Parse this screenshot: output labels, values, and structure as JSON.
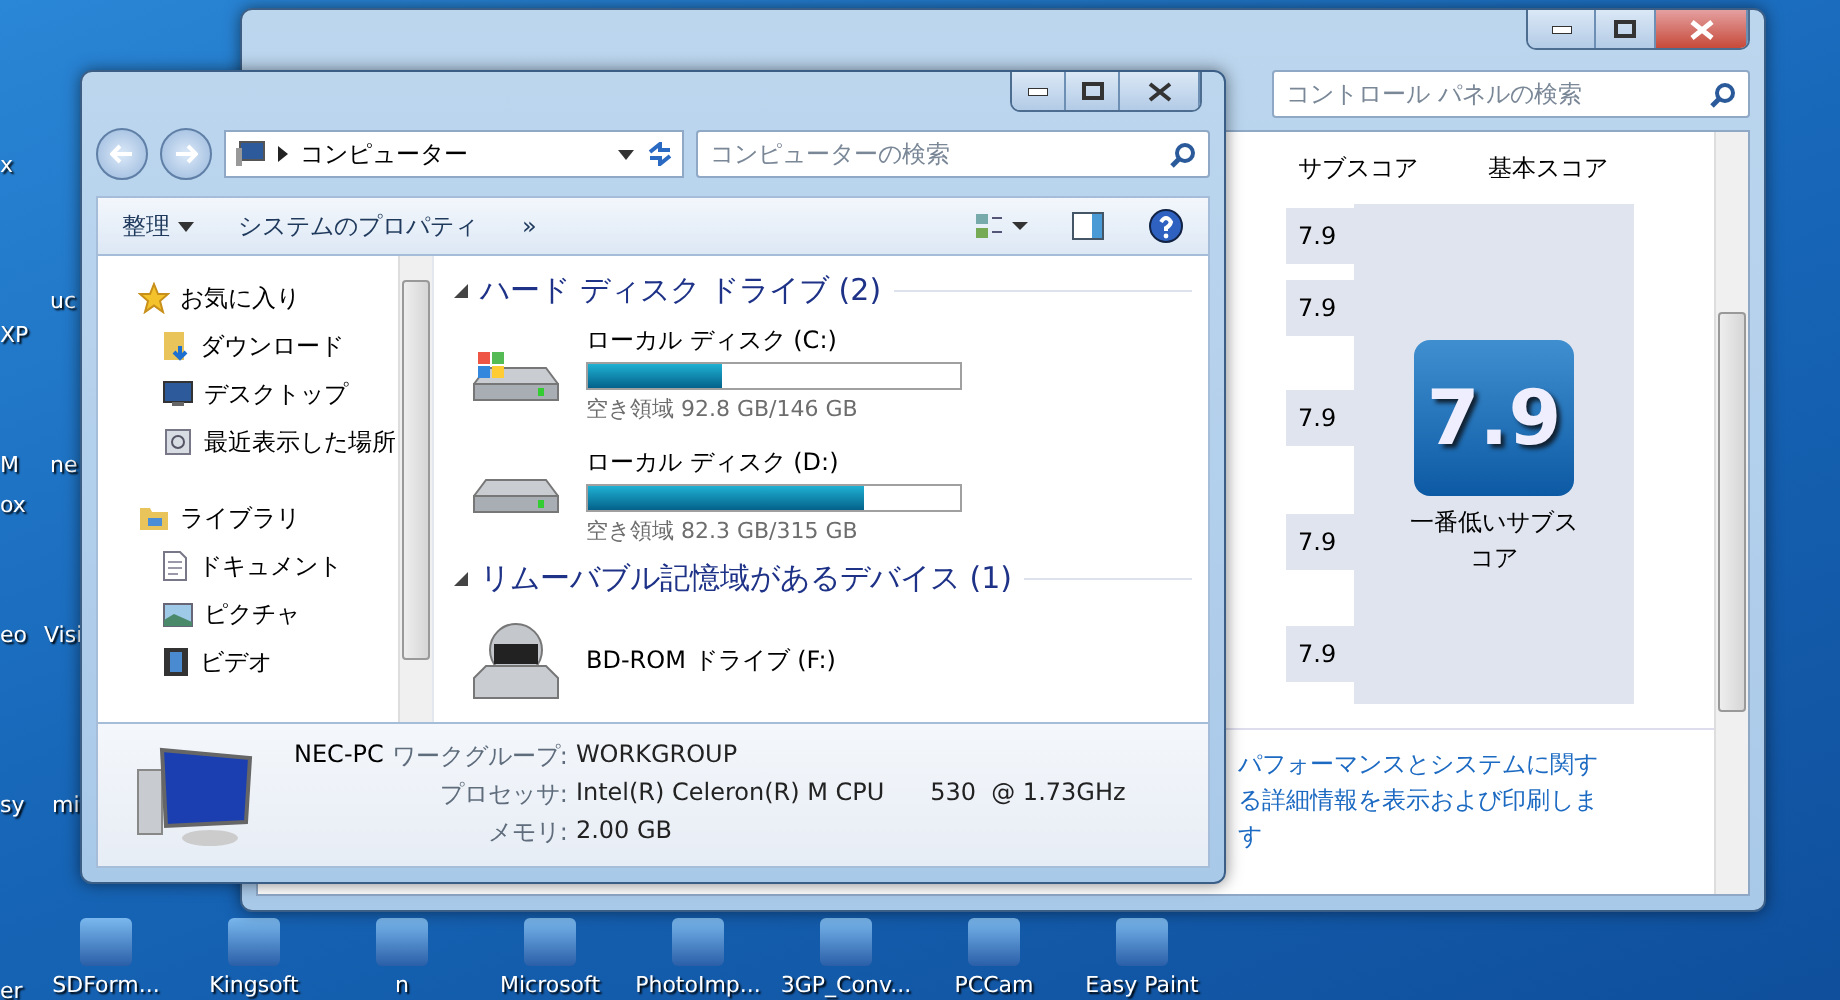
{
  "desktop": {
    "left_labels": [
      "x",
      "uc",
      "XP",
      "M",
      "ne",
      "ox",
      "eo",
      "Visi",
      "sy",
      "mi"
    ],
    "bottom_icons": [
      {
        "label": "er"
      },
      {
        "label": "SDForm..."
      },
      {
        "label": "Kingsoft"
      },
      {
        "label": "n"
      },
      {
        "label": "Microsoft"
      },
      {
        "label": "PhotoImp..."
      },
      {
        "label": "3GP_Conv..."
      },
      {
        "label": "PCCam"
      },
      {
        "label": "Easy Paint"
      }
    ]
  },
  "control_panel": {
    "search_placeholder": "コントロール パネルの検索",
    "columns": [
      "サブスコア",
      "基本スコア"
    ],
    "subscores": [
      "7.9",
      "7.9",
      "7.9",
      "7.9",
      "7.9"
    ],
    "base_score": "7.9",
    "base_caption": "一番低いサブスコア",
    "link": "パフォーマンスとシステムに関する詳細情報を表示および印刷します"
  },
  "explorer": {
    "breadcrumb": "コンピューター",
    "search_placeholder": "コンピューターの検索",
    "toolbar": {
      "organize": "整理",
      "system_properties": "システムのプロパティ",
      "more": "»"
    },
    "nav": [
      {
        "label": "お気に入り",
        "kind": "favorites",
        "children": [
          {
            "label": "ダウンロード",
            "kind": "download"
          },
          {
            "label": "デスクトップ",
            "kind": "desktop"
          },
          {
            "label": "最近表示した場所",
            "kind": "recent"
          }
        ]
      },
      {
        "label": "ライブラリ",
        "kind": "library",
        "children": [
          {
            "label": "ドキュメント",
            "kind": "document"
          },
          {
            "label": "ピクチャ",
            "kind": "picture"
          },
          {
            "label": "ビデオ",
            "kind": "video"
          }
        ]
      }
    ],
    "groups": [
      {
        "title": "ハード ディスク ドライブ (2)",
        "expanded": true,
        "drives": [
          {
            "name": "ローカル ディスク (C:)",
            "kind": "system",
            "level": 0.36,
            "free": "空き領域 92.8 GB/146 GB"
          },
          {
            "name": "ローカル ディスク (D:)",
            "kind": "disk",
            "level": 0.74,
            "free": "空き領域 82.3 GB/315 GB"
          }
        ]
      },
      {
        "title": "リムーバブル記憶域があるデバイス (1)",
        "expanded": true,
        "drives": [
          {
            "name": "BD-ROM ドライブ (F:)",
            "kind": "optical"
          }
        ]
      }
    ],
    "details": {
      "name": "NEC-PC",
      "fields": [
        {
          "label": "ワークグループ:",
          "value": "WORKGROUP"
        },
        {
          "label": "プロセッサ:",
          "value": "Intel(R) Celeron(R) M CPU      530  @ 1.73GHz"
        },
        {
          "label": "メモリ:",
          "value": "2.00 GB"
        }
      ]
    }
  }
}
